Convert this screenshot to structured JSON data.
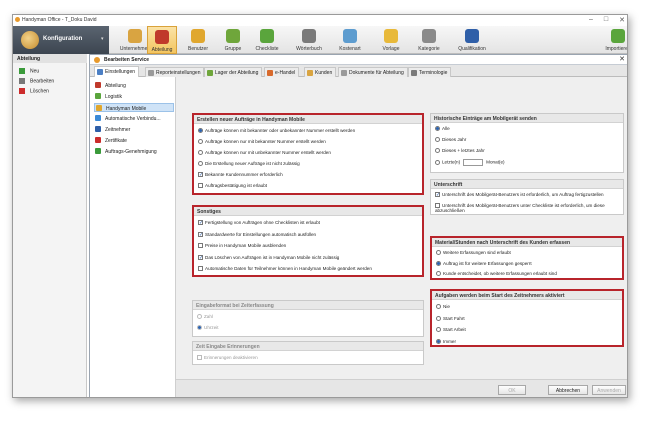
{
  "app": {
    "title": "Handyman Office - T_Doku David"
  },
  "window_controls": [
    "–",
    "□",
    "✕"
  ],
  "ribbon": {
    "konfiguration": "Konfiguration",
    "buttons": [
      {
        "label": "Unternehmen",
        "icon": "building-icon",
        "color": "#d9a441"
      },
      {
        "label": "Abteilung",
        "icon": "department-icon",
        "color": "#c0392b"
      },
      {
        "label": "Benutzer",
        "icon": "user-icon",
        "color": "#e0a72e"
      },
      {
        "label": "Gruppe",
        "icon": "group-icon",
        "color": "#6fa63b"
      },
      {
        "label": "Checkliste",
        "icon": "checklist-icon",
        "color": "#5aa53c"
      },
      {
        "label": "Wörterbuch",
        "icon": "dictionary-icon",
        "color": "#7a7a7a"
      },
      {
        "label": "Kostenart",
        "icon": "cost-type-icon",
        "color": "#5d9ccf"
      },
      {
        "label": "Vorlage",
        "icon": "template-icon",
        "color": "#e8b93a"
      },
      {
        "label": "Kategorie",
        "icon": "category-icon",
        "color": "#8a8a8a"
      },
      {
        "label": "Qualifikation",
        "icon": "qualification-icon",
        "color": "#2f5fa8"
      },
      {
        "label": "Importieren",
        "icon": "import-icon",
        "color": "#5aa53c"
      }
    ]
  },
  "sidebar": {
    "header": "Abteilung",
    "items": [
      {
        "label": "Neu",
        "icon": "plus-icon",
        "color": "#3a9a3a"
      },
      {
        "label": "Bearbeiten",
        "icon": "edit-icon",
        "color": "#777777"
      },
      {
        "label": "Löschen",
        "icon": "delete-icon",
        "color": "#cc2b2b"
      }
    ]
  },
  "dialog": {
    "title": "Bearbeiten Service",
    "close": "✕",
    "tabs": [
      {
        "label": "Einstellungen",
        "color": "#4b7fc4"
      },
      {
        "label": "Reporteinstellungen",
        "color": "#9a9a9a"
      },
      {
        "label": "Lager der Abteilung",
        "color": "#6fa63b"
      },
      {
        "label": "e-Handel",
        "color": "#d86a2c"
      },
      {
        "label": "Kunden",
        "color": "#d9a441"
      },
      {
        "label": "Dokumente für Abteilung",
        "color": "#9a9a9a"
      },
      {
        "label": "Terminologie",
        "color": "#7a7a7a"
      }
    ],
    "nav": [
      {
        "label": "Abteilung",
        "color": "#c0392b"
      },
      {
        "label": "Logistik",
        "color": "#5aa53c"
      },
      {
        "label": "Handyman Mobile",
        "color": "#e0a72e"
      },
      {
        "label": "Automatische Verbindu...",
        "color": "#3a8ad8"
      },
      {
        "label": "Zeitnehmer",
        "color": "#2f5fa8"
      },
      {
        "label": "Zertifikate",
        "color": "#cc2b2b"
      },
      {
        "label": "Auftrags-Genehmigung",
        "color": "#3a9a3a"
      }
    ],
    "groups": {
      "new_orders": {
        "title": "Erstellen neuer Aufträge in Handyman Mobile",
        "options": [
          {
            "label": "Aufträge können mit bekannter oder unbekannter Nummer erstellt werden",
            "type": "radio",
            "checked": true
          },
          {
            "label": "Aufträge können nur mit bekannter Nummer erstellt werden",
            "type": "radio",
            "checked": false
          },
          {
            "label": "Aufträge können nur mit unbekannter Nummer erstellt werden",
            "type": "radio",
            "checked": false
          },
          {
            "label": "Die Erstellung neuer Aufträge ist nicht zulässig",
            "type": "radio",
            "checked": false
          },
          {
            "label": "Bekannte Kundennummer erforderlich",
            "type": "check",
            "checked": true
          },
          {
            "label": "Auftragsbestätigung ist erlaubt",
            "type": "check",
            "checked": false
          }
        ]
      },
      "sonstiges": {
        "title": "Sonstiges",
        "options": [
          {
            "label": "Fertigstellung von Aufträgen ohne Checklisten ist erlaubt",
            "checked": true
          },
          {
            "label": "Standardwerte für Einstellungen automatisch ausfüllen",
            "checked": true
          },
          {
            "label": "Preise in Handyman Mobile ausblenden",
            "checked": false
          },
          {
            "label": "Das Löschen von Aufträgen ist in Handyman Mobile nicht zulässig",
            "checked": true
          },
          {
            "label": "Automatische Daten für Teilnehmer können in Handyman Mobile geändert werden",
            "checked": false
          }
        ]
      },
      "eingabeformat": {
        "title": "Eingabeformat bei Zeiterfassung",
        "options": [
          {
            "label": "Zahl",
            "checked": false
          },
          {
            "label": "Uhrzeit",
            "checked": true
          }
        ]
      },
      "zeit_eingabe": {
        "title": "Zeit Eingabe Erinnerungen",
        "options": [
          {
            "label": "Erinnerungen deaktivieren",
            "checked": false
          }
        ]
      },
      "history": {
        "title": "Historische Einträge am Mobilgerät senden",
        "options": [
          {
            "label": "Alle",
            "checked": true
          },
          {
            "label": "Dieses Jahr",
            "checked": false
          },
          {
            "label": "Dieses + letztes Jahr",
            "checked": false
          },
          {
            "label": "Letzte(n)",
            "checked": false
          }
        ],
        "months_label": "Monat(e)"
      },
      "unterschrift": {
        "title": "Unterschrift",
        "options": [
          {
            "label": "Unterschrift des Mobilgerät-Benutzers ist erforderlich, um Auftrag fertigzustellen",
            "checked": true
          },
          {
            "label": "Unterschrift des Mobilgerät-Benutzers unter Checkliste ist erforderlich, um diese abzuschließen",
            "checked": false
          }
        ]
      },
      "material": {
        "title": "Material/Stunden nach Unterschrift des Kunden erfassen",
        "options": [
          {
            "label": "Weitere Erfassungen sind erlaubt",
            "checked": false
          },
          {
            "label": "Auftrag ist für weitere Erfassungen gesperrt",
            "checked": true
          },
          {
            "label": "Kunde entscheidet, ob weitere Erfassungen erlaubt sind",
            "checked": false
          }
        ]
      },
      "aufgaben": {
        "title": "Aufgaben werden beim Start des Zeitnehmers aktiviert",
        "options": [
          {
            "label": "Nie",
            "checked": false
          },
          {
            "label": "Start Fahrt",
            "checked": false
          },
          {
            "label": "Start Arbeit",
            "checked": false
          },
          {
            "label": "Immer",
            "checked": true
          }
        ]
      }
    },
    "buttons": {
      "ok": "OK",
      "cancel": "Abbrechen",
      "apply": "Anwenden"
    }
  },
  "highlight_color": "#b8242b"
}
